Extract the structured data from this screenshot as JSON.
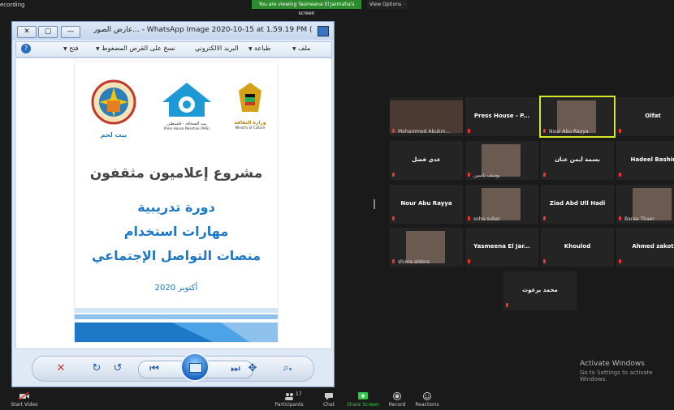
{
  "topbar": {
    "recording_label": "ecording",
    "viewing_banner": "You are viewing Yasmeena El Jarmaha's screen",
    "view_options": "View Options"
  },
  "viewer": {
    "title": "عارض الصور... - WhatsApp Image 2020-10-15 at 1.59.19 PM (1).jpeg",
    "menu": {
      "file": "ملف",
      "print": "طباعة",
      "email": "البريد الالكتروني",
      "burn": "نسخ على القرص المضغوط",
      "open": "فتح"
    },
    "document": {
      "title_main": "مشروع إعلاميون مثقفون",
      "line1": "دورة تدريبية",
      "line2": "مهارات استخدام",
      "line3": "منصات التواصل الإجتماعي",
      "date": "أكتوبر 2020",
      "logo_left_caption": "بيت لحم",
      "logo_center_caption": "بيت الصحافة - فلسطين",
      "logo_center_sub": "Press House Palestine (PHS)",
      "logo_right_caption": "وزارة الثقافة",
      "logo_right_sub": "Ministry of Culture"
    }
  },
  "gallery": {
    "tiles": [
      {
        "name": "",
        "caption": "Mohammed Abukm...",
        "photo": true,
        "active": false
      },
      {
        "name": "Press House - P...",
        "caption": "",
        "photo": false,
        "active": false
      },
      {
        "name": "",
        "caption": "Nour Abu Rayya",
        "photo": true,
        "active": true
      },
      {
        "name": "Olfat",
        "caption": "",
        "photo": false,
        "active": false
      },
      {
        "name": "عدي فضل",
        "caption": "",
        "photo": false,
        "active": false
      },
      {
        "name": "",
        "caption": "يوسف ياسين",
        "photo": true,
        "active": false
      },
      {
        "name": "بسمة أيمن عنان",
        "caption": "",
        "photo": false,
        "active": false
      },
      {
        "name": "Hadeel Bashir",
        "caption": "",
        "photo": false,
        "active": false
      },
      {
        "name": "Nour Abu Rayya",
        "caption": "",
        "photo": false,
        "active": false
      },
      {
        "name": "",
        "caption": "soha subar",
        "photo": true,
        "active": false
      },
      {
        "name": "Ziad Abd Ull Hadi",
        "caption": "",
        "photo": false,
        "active": false
      },
      {
        "name": "",
        "caption": "Baraa Thaer",
        "photo": true,
        "active": false
      },
      {
        "name": "",
        "caption": "shima aldora",
        "photo": true,
        "active": false
      },
      {
        "name": "Yasmeena El Jar...",
        "caption": "",
        "photo": false,
        "active": false
      },
      {
        "name": "Khoulod",
        "caption": "",
        "photo": false,
        "active": false
      },
      {
        "name": "Ahmed zakot",
        "caption": "",
        "photo": false,
        "active": false
      },
      {
        "name": "محمد برغوث",
        "caption": "",
        "photo": false,
        "active": false
      }
    ]
  },
  "watermark": {
    "title": "Activate Windows",
    "subtitle": "Go to Settings to activate Windows."
  },
  "zoombar": {
    "start_video": "Start Video",
    "participants": "Participants",
    "participants_count": "17",
    "chat": "Chat",
    "share_screen": "Share Screen",
    "record": "Record",
    "reactions": "Reactions"
  },
  "colors": {
    "active_border": "#d7e62b",
    "share_green": "#2ecc40",
    "doc_blue": "#1e78c8"
  }
}
